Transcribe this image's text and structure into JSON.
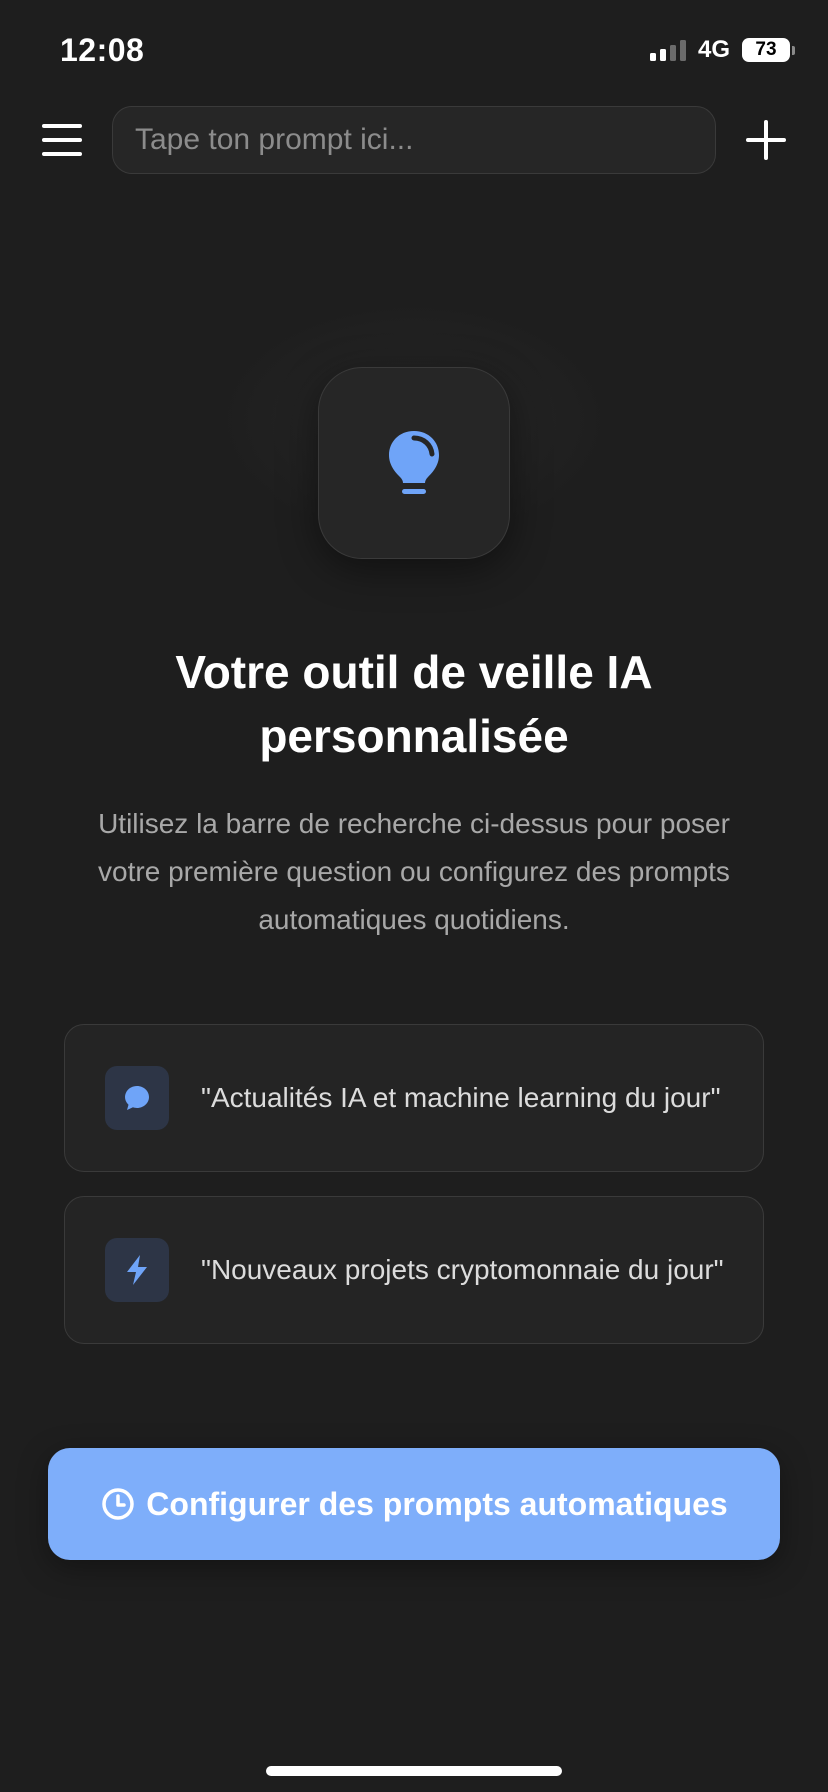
{
  "status_bar": {
    "time": "12:08",
    "network": "4G",
    "battery_level": "73",
    "signal_bars_active": 2,
    "signal_bars_total": 4
  },
  "top_bar": {
    "menu_icon": "hamburger-menu-icon",
    "search_placeholder": "Tape ton prompt ici...",
    "search_value": "",
    "add_icon": "plus-icon"
  },
  "hero": {
    "icon": "lightbulb-icon",
    "title": "Votre outil de veille IA personnalisée",
    "subtitle": "Utilisez la barre de recherche ci-dessus pour poser votre première question ou configurez des prompts automatiques quotidiens."
  },
  "suggestions": [
    {
      "icon": "chat-bubble-icon",
      "text": "\"Actualités IA et machine learning du jour\""
    },
    {
      "icon": "lightning-bolt-icon",
      "text": "\"Nouveaux projets cryptomonnaie du jour\""
    }
  ],
  "cta": {
    "icon": "clock-icon",
    "label": "Configurer des prompts automatiques"
  },
  "colors": {
    "background": "#1e1e1e",
    "accent": "#7eaefa",
    "card": "#242424",
    "icon_blue": "#6fa4f8"
  }
}
